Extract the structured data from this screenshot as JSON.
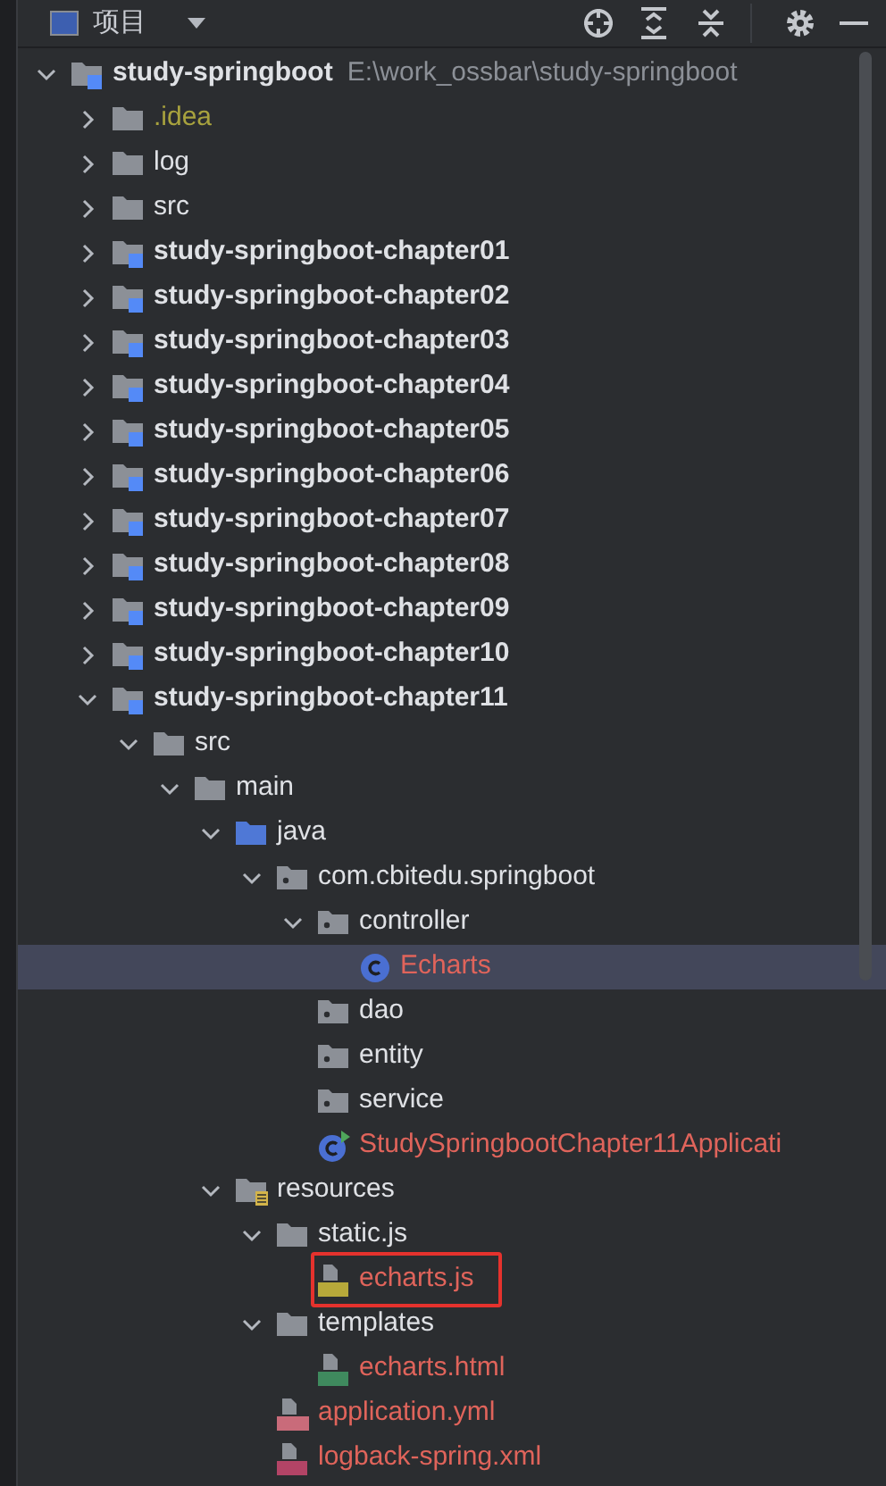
{
  "panel": {
    "title": "项目"
  },
  "tree": [
    {
      "label": "study-springboot",
      "kind": "module",
      "path": "E:\\work_ossbar\\study-springboot",
      "expanded": true,
      "selected": false,
      "unversioned": false,
      "ignored": false,
      "boxed": false,
      "children": [
        {
          "label": ".idea",
          "kind": "folder",
          "expanded": false,
          "selected": false,
          "unversioned": false,
          "ignored": true,
          "boxed": false
        },
        {
          "label": "log",
          "kind": "folder",
          "expanded": false,
          "selected": false,
          "unversioned": false,
          "ignored": false,
          "boxed": false
        },
        {
          "label": "src",
          "kind": "folder",
          "expanded": false,
          "selected": false,
          "unversioned": false,
          "ignored": false,
          "boxed": false
        },
        {
          "label": "study-springboot-chapter01",
          "kind": "module",
          "expanded": false,
          "selected": false,
          "unversioned": false,
          "ignored": false,
          "boxed": false
        },
        {
          "label": "study-springboot-chapter02",
          "kind": "module",
          "expanded": false,
          "selected": false,
          "unversioned": false,
          "ignored": false,
          "boxed": false
        },
        {
          "label": "study-springboot-chapter03",
          "kind": "module",
          "expanded": false,
          "selected": false,
          "unversioned": false,
          "ignored": false,
          "boxed": false
        },
        {
          "label": "study-springboot-chapter04",
          "kind": "module",
          "expanded": false,
          "selected": false,
          "unversioned": false,
          "ignored": false,
          "boxed": false
        },
        {
          "label": "study-springboot-chapter05",
          "kind": "module",
          "expanded": false,
          "selected": false,
          "unversioned": false,
          "ignored": false,
          "boxed": false
        },
        {
          "label": "study-springboot-chapter06",
          "kind": "module",
          "expanded": false,
          "selected": false,
          "unversioned": false,
          "ignored": false,
          "boxed": false
        },
        {
          "label": "study-springboot-chapter07",
          "kind": "module",
          "expanded": false,
          "selected": false,
          "unversioned": false,
          "ignored": false,
          "boxed": false
        },
        {
          "label": "study-springboot-chapter08",
          "kind": "module",
          "expanded": false,
          "selected": false,
          "unversioned": false,
          "ignored": false,
          "boxed": false
        },
        {
          "label": "study-springboot-chapter09",
          "kind": "module",
          "expanded": false,
          "selected": false,
          "unversioned": false,
          "ignored": false,
          "boxed": false
        },
        {
          "label": "study-springboot-chapter10",
          "kind": "module",
          "expanded": false,
          "selected": false,
          "unversioned": false,
          "ignored": false,
          "boxed": false
        },
        {
          "label": "study-springboot-chapter11",
          "kind": "module",
          "expanded": true,
          "selected": false,
          "unversioned": false,
          "ignored": false,
          "boxed": false,
          "children": [
            {
              "label": "src",
              "kind": "folder",
              "expanded": true,
              "selected": false,
              "unversioned": false,
              "ignored": false,
              "boxed": false,
              "children": [
                {
                  "label": "main",
                  "kind": "folder",
                  "expanded": true,
                  "selected": false,
                  "unversioned": false,
                  "ignored": false,
                  "boxed": false,
                  "children": [
                    {
                      "label": "java",
                      "kind": "source",
                      "expanded": true,
                      "selected": false,
                      "unversioned": false,
                      "ignored": false,
                      "boxed": false,
                      "children": [
                        {
                          "label": "com.cbitedu.springboot",
                          "kind": "package",
                          "expanded": true,
                          "selected": false,
                          "unversioned": false,
                          "ignored": false,
                          "boxed": false,
                          "children": [
                            {
                              "label": "controller",
                              "kind": "package",
                              "expanded": true,
                              "selected": false,
                              "unversioned": false,
                              "ignored": false,
                              "boxed": false,
                              "children": [
                                {
                                  "label": "Echarts",
                                  "kind": "class",
                                  "selected": true,
                                  "unversioned": true,
                                  "ignored": false,
                                  "boxed": false
                                }
                              ]
                            },
                            {
                              "label": "dao",
                              "kind": "package",
                              "selected": false,
                              "unversioned": false,
                              "ignored": false,
                              "boxed": false
                            },
                            {
                              "label": "entity",
                              "kind": "package",
                              "selected": false,
                              "unversioned": false,
                              "ignored": false,
                              "boxed": false
                            },
                            {
                              "label": "service",
                              "kind": "package",
                              "selected": false,
                              "unversioned": false,
                              "ignored": false,
                              "boxed": false
                            },
                            {
                              "label": "StudySpringbootChapter11Applicati",
                              "kind": "app",
                              "selected": false,
                              "unversioned": true,
                              "ignored": false,
                              "boxed": false
                            }
                          ]
                        }
                      ]
                    },
                    {
                      "label": "resources",
                      "kind": "resources",
                      "expanded": true,
                      "selected": false,
                      "unversioned": false,
                      "ignored": false,
                      "boxed": false,
                      "children": [
                        {
                          "label": "static.js",
                          "kind": "folder",
                          "expanded": true,
                          "selected": false,
                          "unversioned": false,
                          "ignored": false,
                          "boxed": false,
                          "children": [
                            {
                              "label": "echarts.js",
                              "kind": "js",
                              "selected": false,
                              "unversioned": true,
                              "ignored": false,
                              "boxed": true
                            }
                          ]
                        },
                        {
                          "label": "templates",
                          "kind": "folder",
                          "expanded": true,
                          "selected": false,
                          "unversioned": false,
                          "ignored": false,
                          "boxed": false,
                          "children": [
                            {
                              "label": "echarts.html",
                              "kind": "html",
                              "selected": false,
                              "unversioned": true,
                              "ignored": false,
                              "boxed": false
                            }
                          ]
                        },
                        {
                          "label": "application.yml",
                          "kind": "yml",
                          "selected": false,
                          "unversioned": true,
                          "ignored": false,
                          "boxed": false
                        },
                        {
                          "label": "logback-spring.xml",
                          "kind": "xml",
                          "selected": false,
                          "unversioned": true,
                          "ignored": false,
                          "boxed": false
                        }
                      ]
                    }
                  ]
                }
              ]
            }
          ]
        }
      ]
    }
  ]
}
